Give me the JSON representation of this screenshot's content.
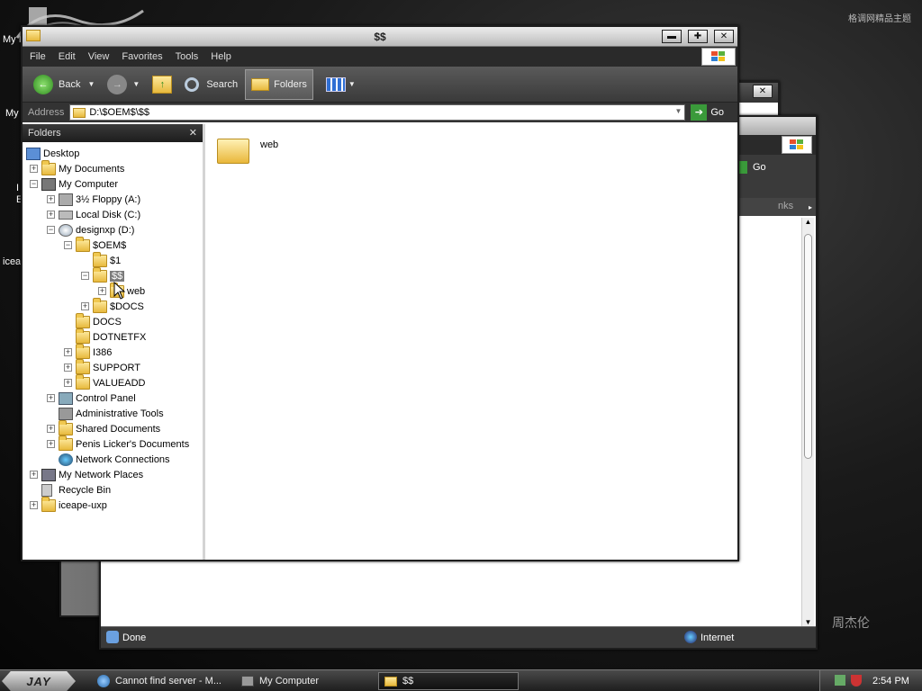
{
  "desktop": {
    "icons": [
      {
        "label": "My I"
      },
      {
        "label": "My"
      },
      {
        "label": "I"
      },
      {
        "label": "E"
      },
      {
        "label": "icea"
      }
    ],
    "watermark": "格调网精品主题",
    "signature": "周杰伦"
  },
  "background_window_2": {
    "go_label": "Go",
    "links_label": "nks",
    "status": {
      "done": "Done",
      "zone": "Internet"
    }
  },
  "explorer": {
    "title": "$$",
    "menu": [
      "File",
      "Edit",
      "View",
      "Favorites",
      "Tools",
      "Help"
    ],
    "toolbar": {
      "back": "Back",
      "search": "Search",
      "folders": "Folders"
    },
    "address": {
      "label": "Address",
      "value": "D:\\$OEM$\\$$",
      "go": "Go"
    },
    "folders_pane": {
      "header": "Folders",
      "close": "✕",
      "tree": [
        {
          "label": "Desktop"
        },
        {
          "label": "My Documents"
        },
        {
          "label": "My Computer"
        },
        {
          "label": "3½ Floppy (A:)"
        },
        {
          "label": "Local Disk (C:)"
        },
        {
          "label": "designxp (D:)"
        },
        {
          "label": "$OEM$"
        },
        {
          "label": "$1"
        },
        {
          "label": "$$"
        },
        {
          "label": "web"
        },
        {
          "label": "$DOCS"
        },
        {
          "label": "DOCS"
        },
        {
          "label": "DOTNETFX"
        },
        {
          "label": "I386"
        },
        {
          "label": "SUPPORT"
        },
        {
          "label": "VALUEADD"
        },
        {
          "label": "Control Panel"
        },
        {
          "label": "Administrative Tools"
        },
        {
          "label": "Shared Documents"
        },
        {
          "label": "Penis Licker's Documents"
        },
        {
          "label": "Network Connections"
        },
        {
          "label": "My Network Places"
        },
        {
          "label": "Recycle Bin"
        },
        {
          "label": "iceape-uxp"
        }
      ]
    },
    "content_items": [
      {
        "label": "web"
      }
    ]
  },
  "taskbar": {
    "start_label": "JAY",
    "buttons": [
      {
        "label": "Cannot find server - M..."
      },
      {
        "label": "My Computer"
      },
      {
        "label": "$$"
      }
    ],
    "clock": "2:54 PM"
  },
  "colors": {
    "accent": "#7b7b7b",
    "go_green": "#3a9a3a",
    "folder": "#f0c850"
  }
}
